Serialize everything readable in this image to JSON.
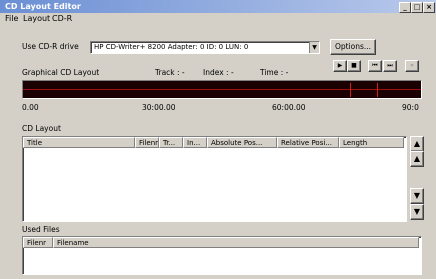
{
  "window": {
    "title": "CD Layout Editor",
    "min": "_",
    "max": "□",
    "close": "×"
  },
  "menu": [
    "File",
    "Layout",
    "CD-R"
  ],
  "drive": {
    "label": "Use CD-R drive",
    "selected": "HP    CD-Writer+ 8200  Adapter: 0  ID: 0  LUN: 0",
    "options_button": "Options..."
  },
  "graphical": {
    "label": "Graphical CD Layout",
    "track": "Track : -",
    "index": "Index : -",
    "time": "Time : -"
  },
  "transport": {
    "play": "▶",
    "stop": "■",
    "prev": "⏮",
    "next": "⏭",
    "forward": "»"
  },
  "timeline": {
    "ticks": [
      "0.00",
      "30:00.00",
      "60:00.00",
      "90:0"
    ],
    "marker_minutes": [
      74,
      80
    ],
    "total_minutes": 90
  },
  "cd_layout": {
    "label": "CD Layout",
    "columns": [
      "Title",
      "Filenr",
      "Tr...",
      "In...",
      "Absolute Pos...",
      "Relative Posi...",
      "Length"
    ]
  },
  "list_buttons": {
    "up1": "▲",
    "up2": "▲",
    "down1": "▼",
    "down2": "▼"
  },
  "used_files": {
    "label": "Used Files",
    "columns": [
      "Filenr",
      "Filename"
    ]
  }
}
